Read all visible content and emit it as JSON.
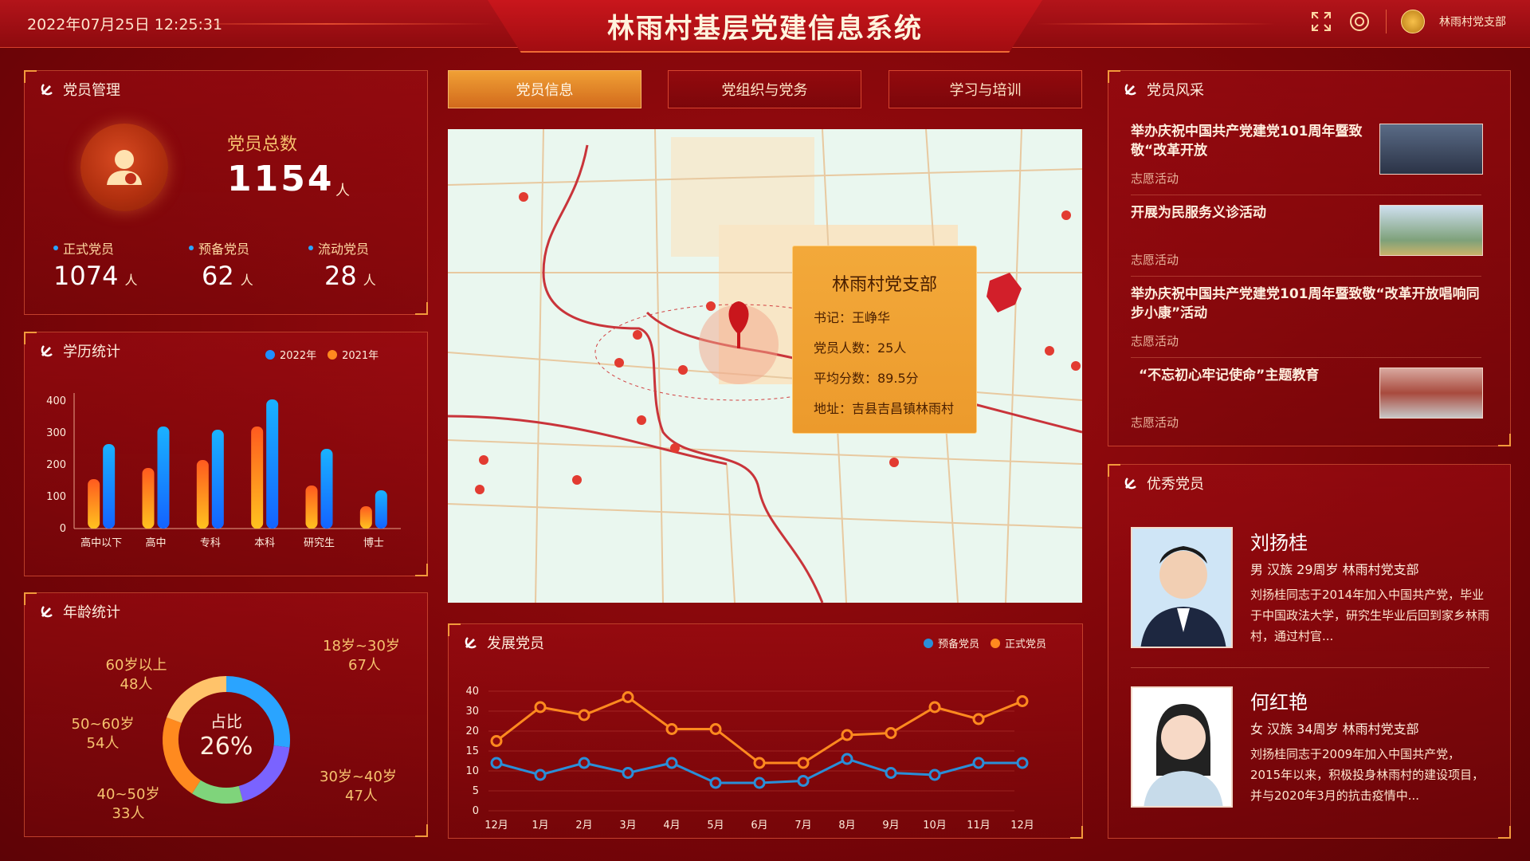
{
  "header": {
    "datetime": "2022年07月25日   12:25:31",
    "title": "林雨村基层党建信息系统",
    "icons": [
      "fullscreen-icon",
      "gear-icon"
    ],
    "user": "林雨村党支部"
  },
  "members": {
    "title": "党员管理",
    "total_label": "党员总数",
    "total_value": "1154",
    "unit": "人",
    "stats": [
      {
        "label": "正式党员",
        "value": "1074",
        "unit": "人"
      },
      {
        "label": "预备党员",
        "value": "62",
        "unit": "人"
      },
      {
        "label": "流动党员",
        "value": "28",
        "unit": "人"
      }
    ]
  },
  "education": {
    "title": "学历统计",
    "chart_data": {
      "type": "bar",
      "categories": [
        "高中以下",
        "高中",
        "专科",
        "本科",
        "研究生",
        "博士"
      ],
      "series": [
        {
          "name": "2022年",
          "values": [
            265,
            320,
            310,
            405,
            250,
            120
          ],
          "color": "#1e8fff"
        },
        {
          "name": "2021年",
          "values": [
            155,
            190,
            215,
            320,
            135,
            70
          ],
          "color": "#ff8a1f"
        }
      ],
      "ylim": [
        0,
        400
      ],
      "yticks": [
        "400",
        "300",
        "200",
        "100",
        "0"
      ]
    }
  },
  "age": {
    "title": "年龄统计",
    "center_label": "占比",
    "center_value": "26%",
    "chart_data": {
      "type": "pie",
      "labels": [
        "18岁~30岁",
        "30岁~40岁",
        "40~50岁",
        "50~60岁",
        "60岁以上"
      ],
      "values": [
        67,
        47,
        33,
        54,
        48
      ],
      "value_text": [
        "67人",
        "47人",
        "33人",
        "54人",
        "48人"
      ],
      "colors": [
        "#2aa4ff",
        "#7a63ff",
        "#7fd47b",
        "#ff8a1f",
        "#ffc36a"
      ]
    }
  },
  "tabs": [
    "党员信息",
    "党组织与党务",
    "学习与培训"
  ],
  "map": {
    "card": {
      "title": "林雨村党支部",
      "rows": [
        "书记：王峥华",
        "党员人数：25人",
        "平均分数：89.5分",
        "地址：吉县吉昌镇林雨村"
      ]
    }
  },
  "develop": {
    "title": "发展党员",
    "chart_data": {
      "type": "line",
      "x": [
        "12月",
        "1月",
        "2月",
        "3月",
        "4月",
        "5月",
        "6月",
        "7月",
        "8月",
        "9月",
        "10月",
        "11月",
        "12月"
      ],
      "series": [
        {
          "name": "预备党员",
          "values": [
            12,
            9,
            12,
            9.5,
            12,
            7,
            7,
            7.5,
            13,
            9.5,
            9,
            12,
            12
          ],
          "color": "#2a8fd8"
        },
        {
          "name": "正式党员",
          "values": [
            17.5,
            32,
            28,
            37,
            21,
            21,
            12,
            12,
            19,
            19.5,
            32,
            26,
            35
          ],
          "color": "#ff8a1f"
        }
      ],
      "yticks": [
        "40",
        "30",
        "20",
        "15",
        "10",
        "5",
        "0"
      ]
    }
  },
  "news": {
    "title": "党员风采",
    "items": [
      {
        "title": "举办庆祝中国共产党建党101周年暨致敬“改革开放",
        "tag": "志愿活动"
      },
      {
        "title": "开展为民服务义诊活动",
        "tag": "志愿活动"
      },
      {
        "title": "举办庆祝中国共产党建党101周年暨致敬“改革开放唱响同步小康”活动",
        "tag": "志愿活动"
      },
      {
        "title": "“不忘初心牢记使命”主题教育",
        "tag": "志愿活动"
      }
    ]
  },
  "excellent": {
    "title": "优秀党员",
    "people": [
      {
        "name": "刘扬桂",
        "meta": "男 汉族 29周岁 林雨村党支部",
        "desc": "刘扬桂同志于2014年加入中国共产党，毕业于中国政法大学，研究生毕业后回到家乡林雨村，通过村官..."
      },
      {
        "name": "何红艳",
        "meta": "女 汉族 34周岁 林雨村党支部",
        "desc": "刘扬桂同志于2009年加入中国共产党，2015年以来，积极投身林雨村的建设项目，并与2020年3月的抗击疫情中..."
      }
    ]
  }
}
